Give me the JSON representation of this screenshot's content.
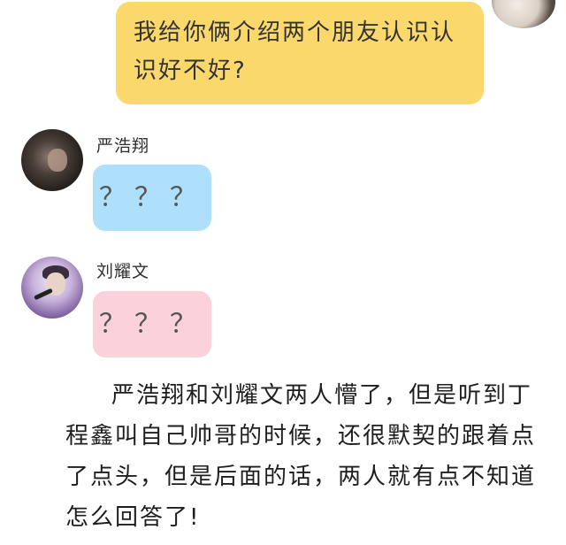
{
  "outgoing_message": {
    "text": "我给你俩介绍两个朋友认识认识好不好?"
  },
  "messages": [
    {
      "sender": "严浩翔",
      "text": "？？？",
      "bubble_color": "#aee0fb"
    },
    {
      "sender": "刘耀文",
      "text": "？？？",
      "bubble_color": "#fbd2dc"
    }
  ],
  "caption": {
    "text": "严浩翔和刘耀文两人懵了，但是听到丁程鑫叫自己帅哥的时候，还很默契的跟着点了点头，但是后面的话，两人就有点不知道怎么回答了!"
  },
  "colors": {
    "outgoing_bubble": "#fbd86c",
    "background": "#ffffff"
  }
}
